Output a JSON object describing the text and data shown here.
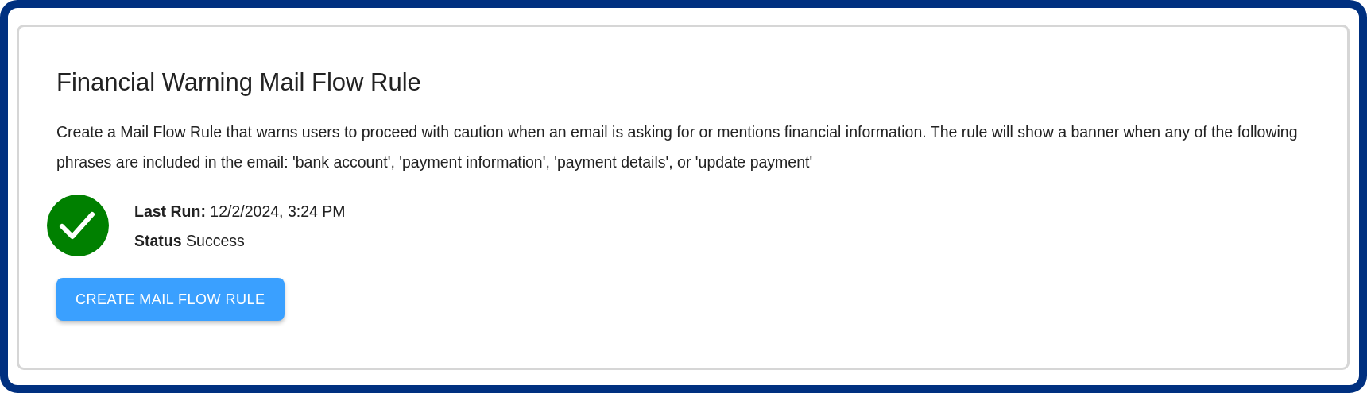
{
  "card": {
    "title": "Financial Warning Mail Flow Rule",
    "description": "Create a Mail Flow Rule that warns users to proceed with caution when an email is asking for or mentions financial information. The rule will show a banner when any of the following phrases are included in the email: 'bank account', 'payment information', 'payment details', or 'update payment'",
    "status": {
      "kind": "success",
      "lines": [
        {
          "label": "Last Run:",
          "value": "12/2/2024, 3:24 PM"
        },
        {
          "label": "Status",
          "value": "Success"
        }
      ]
    },
    "button": {
      "label": "CREATE MAIL FLOW RULE"
    }
  }
}
